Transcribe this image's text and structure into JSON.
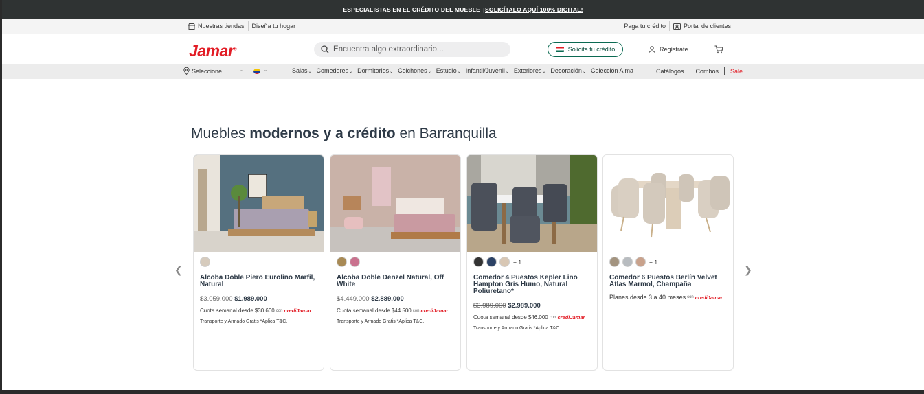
{
  "promo": {
    "text": "ESPECIALISTAS EN EL CRÉDITO DEL MUEBLE",
    "link": "¡SOLICÍTALO AQUÍ 100% DIGITAL!"
  },
  "util": {
    "left": [
      "Nuestras tiendas",
      "Diseña tu hogar"
    ],
    "right": [
      "Paga tu crédito",
      "Portal de clientes"
    ]
  },
  "header": {
    "logo": "Jamar",
    "search_placeholder": "Encuentra algo extraordinario...",
    "credit_button": "Solicita tu crédito",
    "register": "Regístrate"
  },
  "nav": {
    "location": "Seleccione",
    "categories": [
      "Salas",
      "Comedores",
      "Dormitorios",
      "Colchones",
      "Estudio",
      "Infantil/Juvenil",
      "Exteriores",
      "Decoración",
      "Colección Alma"
    ],
    "right": [
      "Catálogos",
      "Combos",
      "Sale"
    ]
  },
  "section": {
    "title_pre": "Muebles ",
    "title_bold": "modernos y a crédito",
    "title_post": " en Barranquilla"
  },
  "products": [
    {
      "name": "Alcoba Doble Piero Eurolino Marfil, Natural",
      "old_price": "$3.059.000",
      "price": "$1.989.000",
      "cuota_label": "Cuota semanal desde",
      "cuota": "$30.600",
      "con": "con",
      "credi": "crediJamar",
      "transport": "Transporte y Armado Gratis *Aplica T&C.",
      "swatches": [
        "#d6cbbd"
      ],
      "more": ""
    },
    {
      "name": "Alcoba Doble Denzel Natural, Off White",
      "old_price": "$4.449.000",
      "price": "$2.889.000",
      "cuota_label": "Cuota semanal desde",
      "cuota": "$44.500",
      "con": "con",
      "credi": "crediJamar",
      "transport": "Transporte y Armado Gratis *Aplica T&C.",
      "swatches": [
        "#a88a55",
        "#c9728e"
      ],
      "more": ""
    },
    {
      "name": "Comedor 4 Puestos Kepler Lino Hampton Gris Humo, Natural Poliuretano*",
      "old_price": "$3.989.000",
      "price": "$2.989.000",
      "cuota_label": "Cuota semanal desde",
      "cuota": "$46.000",
      "con": "con",
      "credi": "crediJamar",
      "transport": "Transporte y Armado Gratis *Aplica T&C.",
      "swatches": [
        "#333333",
        "#2c4265",
        "#d8c7b4"
      ],
      "more": "+ 1"
    },
    {
      "name": "Comedor 6 Puestos Berlín Velvet Atlas Marmol, Champaña",
      "planes": "Planes desde 3 a 40 meses",
      "con": "con",
      "credi": "crediJamar",
      "swatches": [
        "#a39480",
        "#b8bcc0",
        "#c9a28c"
      ],
      "more": "+ 1"
    }
  ]
}
